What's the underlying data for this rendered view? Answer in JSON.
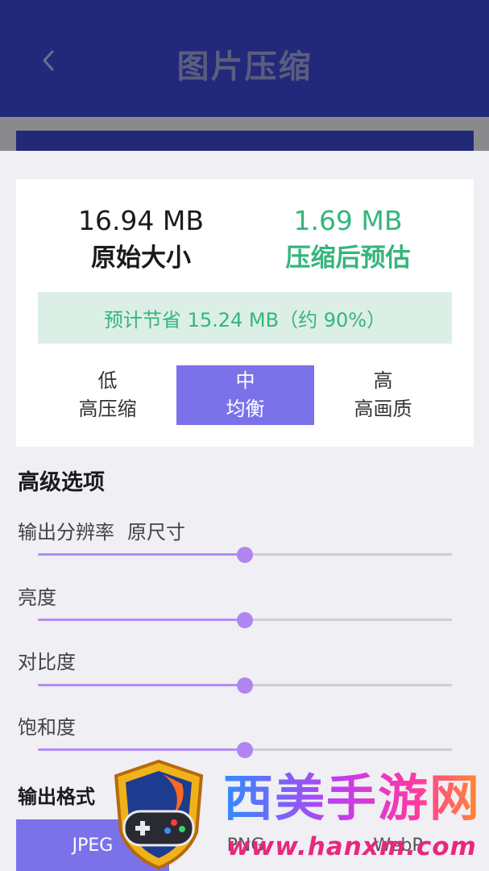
{
  "header": {
    "title": "图片压缩",
    "back_icon": "chevron-left-icon"
  },
  "summary": {
    "original_size": "16.94 MB",
    "original_label": "原始大小",
    "compressed_size": "1.69 MB",
    "compressed_label": "压缩后预估",
    "saving_text": "预计节省 15.24 MB（约 90%）"
  },
  "levels": [
    {
      "name": "低",
      "desc": "高压缩",
      "selected": false
    },
    {
      "name": "中",
      "desc": "均衡",
      "selected": true
    },
    {
      "name": "高",
      "desc": "高画质",
      "selected": false
    }
  ],
  "advanced": {
    "title": "高级选项",
    "resolution_label": "输出分辨率",
    "resolution_value": "原尺寸",
    "resolution_level": 0.5,
    "brightness_label": "亮度",
    "brightness_level": 0.5,
    "contrast_label": "对比度",
    "contrast_level": 0.5,
    "saturation_label": "饱和度",
    "saturation_level": 0.5
  },
  "output_format": {
    "title": "输出格式",
    "options": [
      "JPEG",
      "PNG",
      "WebP"
    ],
    "selected": "JPEG"
  },
  "colors": {
    "header_bg": "#22297a",
    "accent": "#7b72ea",
    "slider": "#b085f0",
    "savings_green": "#35b57c"
  },
  "watermark": {
    "brand": "西美手游网",
    "url": "www.hanxm.com",
    "logo_icon": "gamepad-shield-icon"
  }
}
